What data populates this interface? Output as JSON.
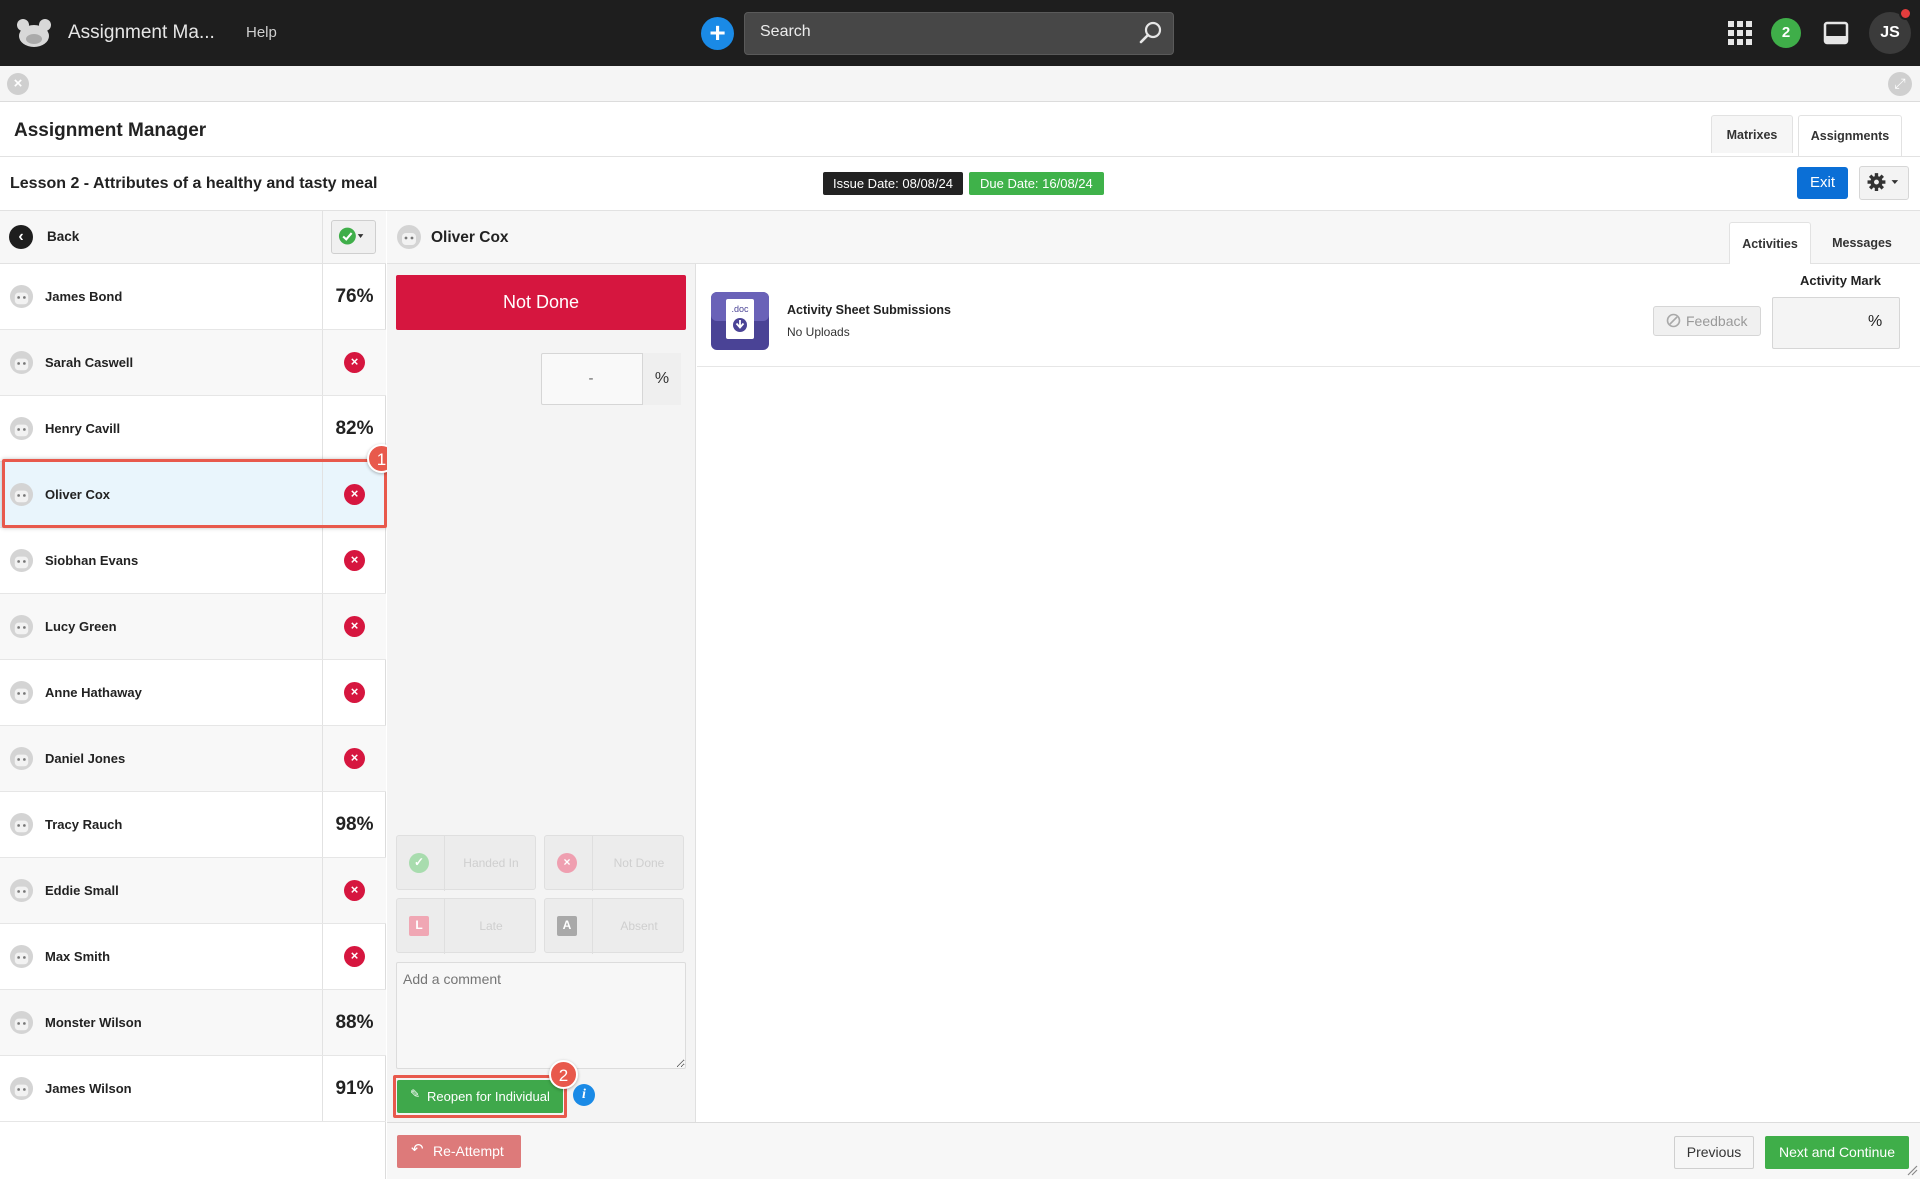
{
  "topbar": {
    "app_title": "Assignment Ma...",
    "help": "Help",
    "search_placeholder": "Search",
    "notifications_count": "2",
    "user_initials": "JS"
  },
  "page": {
    "title": "Assignment Manager",
    "tabs": [
      "Matrixes",
      "Assignments"
    ],
    "active_tab": "Assignments"
  },
  "lesson": {
    "title": "Lesson 2 - Attributes of a healthy and tasty meal",
    "issue_date": "Issue Date: 08/08/24",
    "due_date": "Due Date: 16/08/24",
    "exit_label": "Exit"
  },
  "left_panel": {
    "back_label": "Back",
    "students": [
      {
        "name": "James Bond",
        "score": "76%",
        "status": "done"
      },
      {
        "name": "Sarah Caswell",
        "score": "",
        "status": "not-done"
      },
      {
        "name": "Henry Cavill",
        "score": "82%",
        "status": "done"
      },
      {
        "name": "Oliver Cox",
        "score": "",
        "status": "not-done",
        "selected": true
      },
      {
        "name": "Siobhan Evans",
        "score": "",
        "status": "not-done"
      },
      {
        "name": "Lucy Green",
        "score": "",
        "status": "not-done"
      },
      {
        "name": "Anne Hathaway",
        "score": "",
        "status": "not-done"
      },
      {
        "name": "Daniel Jones",
        "score": "",
        "status": "not-done"
      },
      {
        "name": "Tracy Rauch",
        "score": "98%",
        "status": "done"
      },
      {
        "name": "Eddie Small",
        "score": "",
        "status": "not-done"
      },
      {
        "name": "Max Smith",
        "score": "",
        "status": "not-done"
      },
      {
        "name": "Monster Wilson",
        "score": "88%",
        "status": "done"
      },
      {
        "name": "James Wilson",
        "score": "91%",
        "status": "done"
      }
    ]
  },
  "student_panel": {
    "name": "Oliver Cox",
    "tabs": [
      "Activities",
      "Messages"
    ],
    "active_tab": "Activities",
    "status_banner": "Not Done",
    "mark_value": "-",
    "mark_unit": "%",
    "status_buttons": [
      {
        "label": "Handed In",
        "icon": "check-icon"
      },
      {
        "label": "Not Done",
        "icon": "x-icon"
      },
      {
        "label": "Late",
        "icon": "L"
      },
      {
        "label": "Absent",
        "icon": "A"
      }
    ],
    "comment_placeholder": "Add a comment",
    "reopen_label": "Reopen for Individual",
    "info_icon": "i"
  },
  "activity": {
    "icon_text": ".doc",
    "title": "Activity Sheet Submissions",
    "subtitle": "No Uploads",
    "mark_label": "Activity Mark",
    "feedback_label": "Feedback",
    "mark_unit": "%"
  },
  "footer": {
    "reattempt_label": "Re-Attempt",
    "previous_label": "Previous",
    "next_label": "Next and Continue"
  },
  "callouts": [
    "1",
    "2"
  ],
  "colors": {
    "topbar": "#1e1e1e",
    "not_done_red": "#d6163f",
    "primary_blue": "#0b6fd6",
    "success_green": "#3fae49",
    "callout_orange": "#e8594c",
    "selected_row": "#e9f5fc"
  }
}
